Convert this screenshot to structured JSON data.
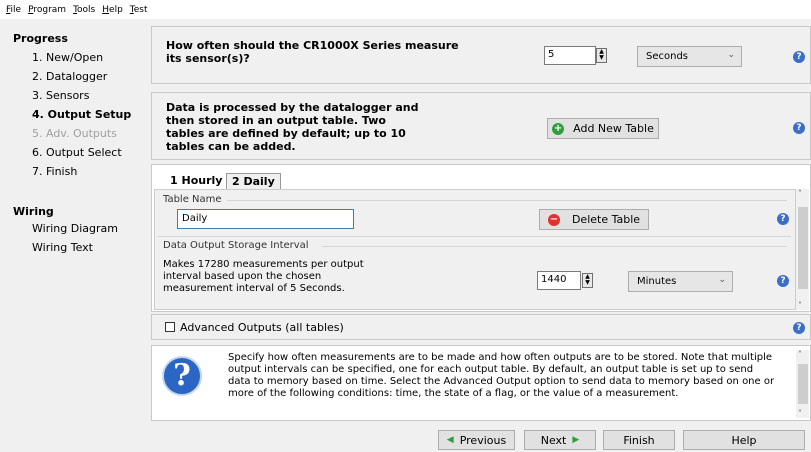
{
  "menu": [
    "File",
    "Program",
    "Tools",
    "Help",
    "Test"
  ],
  "nav": {
    "progress_header": "Progress",
    "steps": [
      "1. New/Open",
      "2. Datalogger",
      "3. Sensors",
      "4. Output Setup",
      "5. Adv. Outputs",
      "6. Output Select",
      "7. Finish"
    ],
    "wiring_header": "Wiring",
    "wiring_links": [
      "Wiring Diagram",
      "Wiring Text"
    ]
  },
  "measure": {
    "question": "How often should the CR1000X Series measure its sensor(s)?",
    "value": "5",
    "unit": "Seconds"
  },
  "tables_info": {
    "text": "Data is processed by the datalogger and then stored in an output table. Two tables are defined by default; up to 10 tables can be added.",
    "add_button": "Add New Table"
  },
  "tabs": [
    {
      "label": "1 Hourly",
      "active": false
    },
    {
      "label": "2 Daily",
      "active": true
    }
  ],
  "table": {
    "name_label": "Table Name",
    "name_value": "Daily",
    "delete_button": "Delete Table",
    "interval_label": "Data Output Storage Interval",
    "interval_text": "Makes 17280 measurements per output interval based upon the chosen measurement interval of 5 Seconds.",
    "interval_value": "1440",
    "interval_unit": "Minutes"
  },
  "advanced": {
    "label": "Advanced Outputs (all tables)",
    "checked": false
  },
  "info": {
    "text": "Specify how often measurements are to be made and how often outputs are to be stored. Note that multiple output intervals can be specified, one for each output table. By default, an output table is set up to send data to memory based on time. Select the Advanced Output option to send data to memory based on one or more of the following conditions: time, the state of a flag, or the value of a measurement."
  },
  "footer": {
    "previous": "Previous",
    "next": "Next",
    "finish": "Finish",
    "help": "Help"
  },
  "colors": {
    "help_icon": "#3a6ec9",
    "add_icon": "#2e9e3e",
    "delete_icon": "#e53030",
    "info_icon": "#2b66c4"
  }
}
